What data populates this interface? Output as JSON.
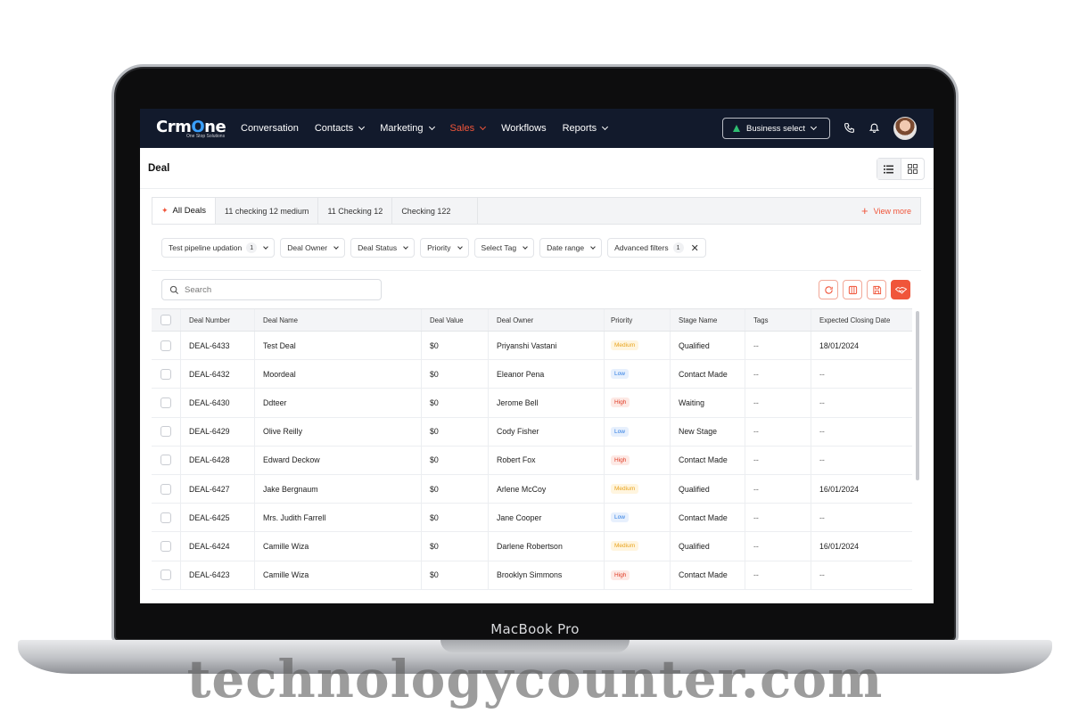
{
  "brand": {
    "name_pre": "Crm",
    "name_o": "O",
    "name_post": "ne",
    "tagline": "One Stop Solutions",
    "accent": "#f0553a",
    "nav_bg": "#121a2c"
  },
  "nav": {
    "items": [
      {
        "label": "Conversation",
        "dropdown": false,
        "active": false
      },
      {
        "label": "Contacts",
        "dropdown": true,
        "active": false
      },
      {
        "label": "Marketing",
        "dropdown": true,
        "active": false
      },
      {
        "label": "Sales",
        "dropdown": true,
        "active": true
      },
      {
        "label": "Workflows",
        "dropdown": false,
        "active": false
      },
      {
        "label": "Reports",
        "dropdown": true,
        "active": false
      }
    ],
    "business_select": "Business select"
  },
  "page": {
    "title": "Deal"
  },
  "tabs": {
    "items": [
      "All Deals",
      "11 checking 12 medium",
      "11 Checking 12",
      "Checking 122"
    ],
    "view_more": "View more"
  },
  "filters": {
    "pipeline": {
      "label": "Test pipeline updation",
      "count": "1"
    },
    "owner": "Deal Owner",
    "status": "Deal Status",
    "priority": "Priority",
    "tag": "Select Tag",
    "date_range": "Date range",
    "advanced": {
      "label": "Advanced filters",
      "count": "1"
    }
  },
  "search": {
    "placeholder": "Search"
  },
  "table": {
    "columns": [
      "Deal Number",
      "Deal Name",
      "Deal Value",
      "Deal Owner",
      "Priority",
      "Stage Name",
      "Tags",
      "Expected Closing Date"
    ],
    "rows": [
      [
        "DEAL-6433",
        "Test Deal",
        "$0",
        "Priyanshi Vastani",
        "Medium",
        "Qualified",
        "--",
        "18/01/2024"
      ],
      [
        "DEAL-6432",
        "Moordeal",
        "$0",
        "Eleanor Pena",
        "Low",
        "Contact Made",
        "--",
        "--"
      ],
      [
        "DEAL-6430",
        "Ddteer",
        "$0",
        "Jerome Bell",
        "High",
        "Waiting",
        "--",
        "--"
      ],
      [
        "DEAL-6429",
        "Olive Reilly",
        "$0",
        "Cody Fisher",
        "Low",
        "New Stage",
        "--",
        "--"
      ],
      [
        "DEAL-6428",
        "Edward Deckow",
        "$0",
        "Robert Fox",
        "High",
        "Contact Made",
        "--",
        "--"
      ],
      [
        "DEAL-6427",
        "Jake Bergnaum",
        "$0",
        "Arlene McCoy",
        "Medium",
        "Qualified",
        "--",
        "16/01/2024"
      ],
      [
        "DEAL-6425",
        "Mrs. Judith Farrell",
        "$0",
        "Jane Cooper",
        "Low",
        "Contact Made",
        "--",
        "--"
      ],
      [
        "DEAL-6424",
        "Camille Wiza",
        "$0",
        "Darlene Robertson",
        "Medium",
        "Qualified",
        "--",
        "16/01/2024"
      ],
      [
        "DEAL-6423",
        "Camille Wiza",
        "$0",
        "Brooklyn Simmons",
        "High",
        "Contact Made",
        "--",
        "--"
      ]
    ]
  },
  "device": {
    "label": "MacBook Pro"
  },
  "watermark": {
    "text": "technologycounter.com"
  }
}
